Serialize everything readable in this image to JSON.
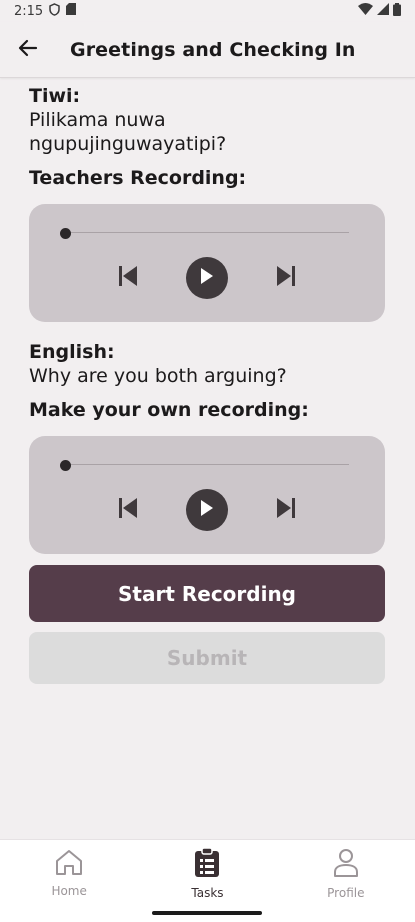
{
  "status_bar": {
    "time": "2:15"
  },
  "app_bar": {
    "title": "Greetings and Checking In"
  },
  "content": {
    "tiwi_label": "Tiwi:",
    "tiwi_text": "Pilikama nuwa ngupujinguwayatipi?",
    "teachers_recording_label": "Teachers Recording:",
    "english_label": "English:",
    "english_text": "Why are you both arguing?",
    "own_recording_label": "Make your own recording:"
  },
  "players": [
    {
      "progress": 0
    },
    {
      "progress": 0
    }
  ],
  "buttons": {
    "start_recording": "Start Recording",
    "submit": "Submit"
  },
  "bottom_nav": {
    "items": [
      {
        "label": "Home",
        "icon": "home-icon",
        "active": false
      },
      {
        "label": "Tasks",
        "icon": "clipboard-icon",
        "active": true
      },
      {
        "label": "Profile",
        "icon": "person-icon",
        "active": false
      }
    ]
  },
  "colors": {
    "primary": "#553d4a",
    "player_bg": "#ccc6ca",
    "background": "#f2eff0",
    "disabled": "#dcdcdc"
  }
}
